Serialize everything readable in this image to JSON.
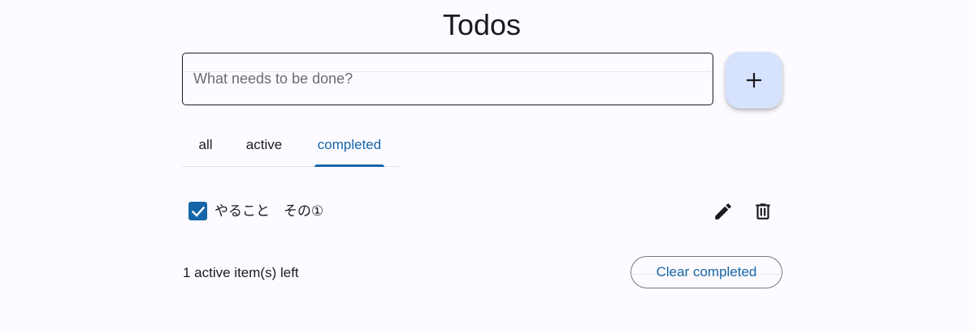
{
  "app": {
    "title": "Todos"
  },
  "new_todo": {
    "placeholder": "What needs to be done?",
    "value": "",
    "add_icon": "plus-icon"
  },
  "tabs": [
    {
      "label": "all",
      "selected": false
    },
    {
      "label": "active",
      "selected": false
    },
    {
      "label": "completed",
      "selected": true
    }
  ],
  "todos": [
    {
      "text": "やること　その①",
      "completed": true,
      "edit_icon": "pencil-icon",
      "delete_icon": "trash-icon"
    }
  ],
  "footer": {
    "items_left": "1 active item(s) left",
    "clear_label": "Clear completed"
  },
  "colors": {
    "primary": "#1565a8",
    "fab_background": "#d7e3fc",
    "background": "#fdfbff",
    "text": "#1b1b1f"
  }
}
